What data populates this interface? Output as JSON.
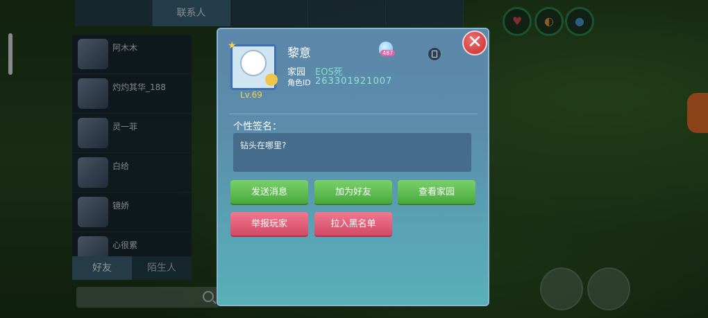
{
  "background": {
    "top_tabs": [
      "",
      "联系人",
      "",
      "",
      ""
    ],
    "contacts": [
      {
        "name": "阿木木",
        "status": "",
        "online": false
      },
      {
        "name": "灼灼其华_188",
        "status": "",
        "online": true
      },
      {
        "name": "灵一菲",
        "status": "",
        "online": true
      },
      {
        "name": "白给",
        "status": "",
        "online": false
      },
      {
        "name": "镜娇",
        "status": "",
        "online": false
      },
      {
        "name": "心很累",
        "status": "",
        "online": false
      }
    ],
    "bottom_tabs": [
      "好友",
      "陌生人"
    ],
    "search_placeholder": ""
  },
  "profile": {
    "name": "黎意",
    "level": "Lv.69",
    "heart_count": "487",
    "garden_label": "家园",
    "garden_value": "EOS死",
    "role_id_label": "角色ID",
    "role_id_value": "263301921007",
    "signature_label": "个性签名：",
    "signature_text": "钻头在哪里?"
  },
  "actions": {
    "send_message": "发送消息",
    "add_friend": "加为好友",
    "view_garden": "查看家园",
    "report_player": "举报玩家",
    "blacklist": "拉入黑名单"
  },
  "close_symbol": "✕",
  "colors": {
    "dialog_top": "#5c86aa",
    "dialog_bottom": "#58b0b6",
    "green_button": "#4aa93e",
    "pink_button": "#d24a66",
    "id_text": "#8fe3d4",
    "level_text": "#f1d25a"
  }
}
